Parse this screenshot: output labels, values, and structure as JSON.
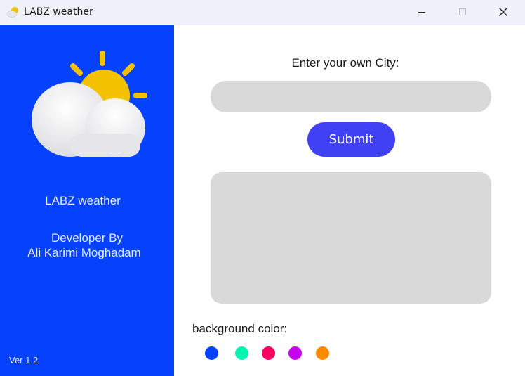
{
  "window": {
    "title": "LABZ weather",
    "controls": [
      "minimize",
      "maximize",
      "close"
    ]
  },
  "sidebar": {
    "background": "#0642fb",
    "logo_icon": "sun-behind-cloud-icon",
    "app_name": "LABZ weather",
    "developer_label": "Developer By",
    "developer_name": "Ali Karimi Moghadam",
    "version": "Ver 1.2"
  },
  "main": {
    "city_prompt": "Enter your own City:",
    "city_input_value": "",
    "submit_label": "Submit",
    "result_text": "",
    "background_color_label": "background color:",
    "color_options": [
      "#0642fb",
      "#00f5b0",
      "#fb0060",
      "#c800f0",
      "#ff8a00"
    ]
  },
  "colors": {
    "accent_button": "#4040f5",
    "field_background": "#d9d9d9"
  }
}
